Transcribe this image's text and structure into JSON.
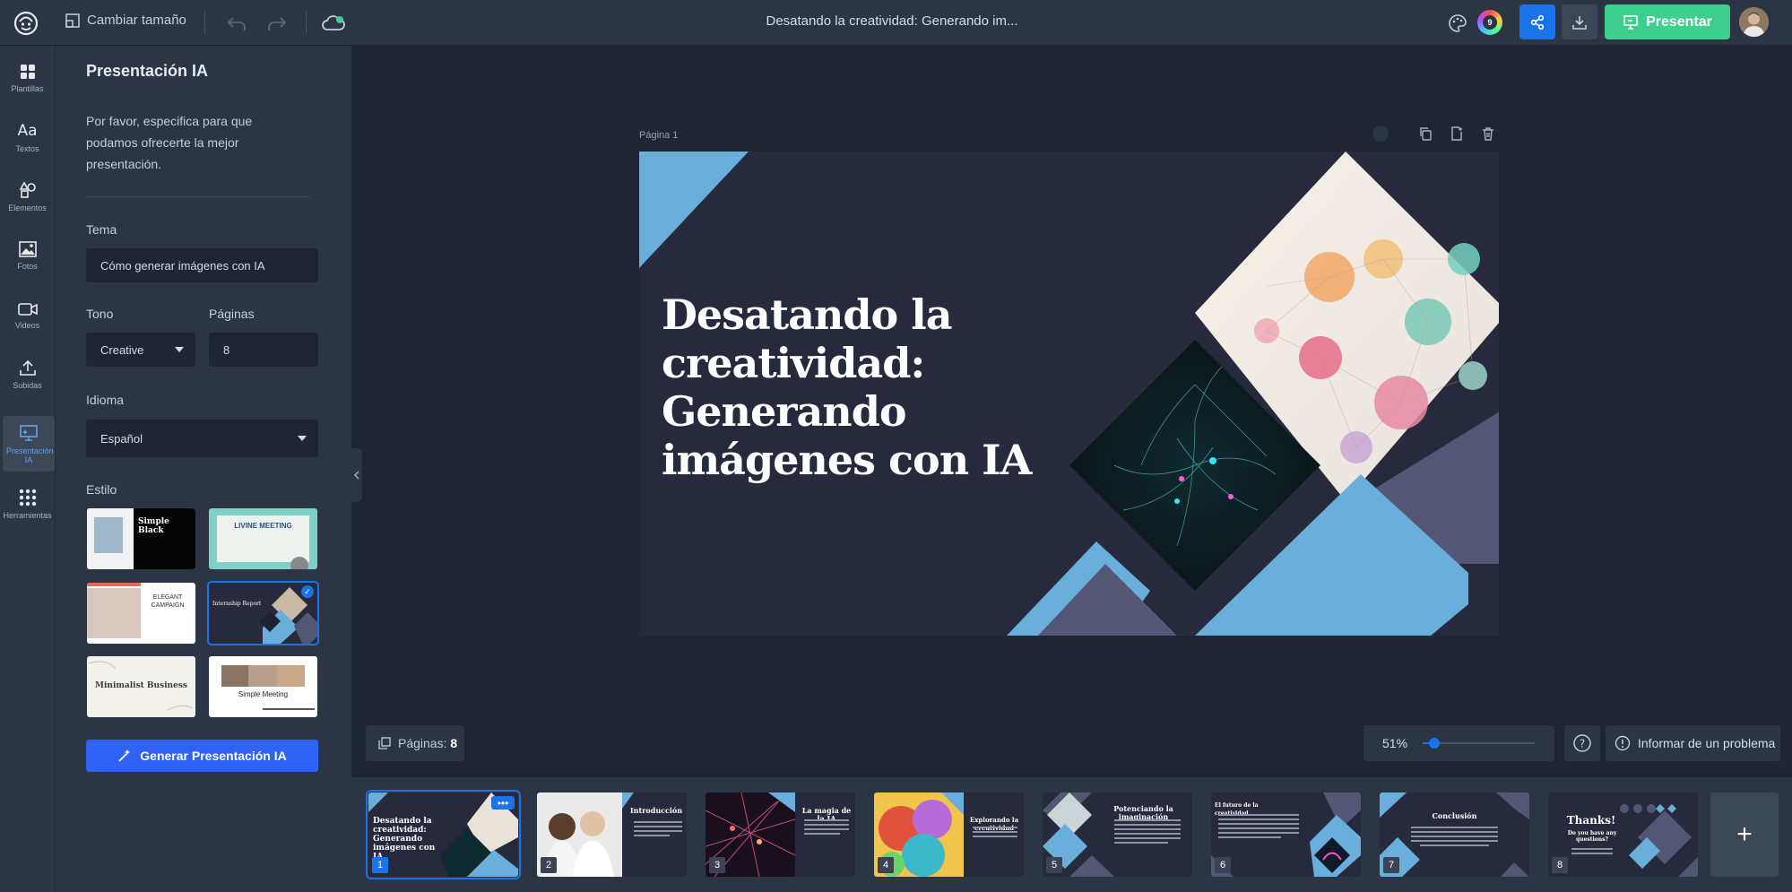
{
  "topbar": {
    "resize_label": "Cambiar tamaño",
    "document_title": "Desatando la creatividad: Generando im...",
    "color_badge": "9",
    "present_label": "Presentar"
  },
  "rail": {
    "items": [
      {
        "label": "Plantillas",
        "icon": "templates-icon"
      },
      {
        "label": "Textos",
        "icon": "text-icon"
      },
      {
        "label": "Elementos",
        "icon": "elements-icon"
      },
      {
        "label": "Fotos",
        "icon": "photos-icon"
      },
      {
        "label": "Videos",
        "icon": "video-icon"
      },
      {
        "label": "Subidas",
        "icon": "upload-icon"
      },
      {
        "label": "Presentación IA",
        "icon": "ai-presentation-icon"
      },
      {
        "label": "Herramientas",
        "icon": "tools-icon"
      }
    ]
  },
  "panel": {
    "title": "Presentación IA",
    "description": "Por favor, especifica para que podamos ofrecerte la mejor presentación.",
    "topic_label": "Tema",
    "topic_value": "Cómo generar imágenes con IA",
    "tone_label": "Tono",
    "tone_value": "Creative",
    "pages_label": "Páginas",
    "pages_value": "8",
    "language_label": "Idioma",
    "language_value": "Español",
    "style_label": "Estilo",
    "styles": [
      {
        "name": "Simple Black"
      },
      {
        "name": "LIVINE MEETING"
      },
      {
        "name": "ELEGANT CAMPAIGN"
      },
      {
        "name": "Internship Report",
        "selected": true
      },
      {
        "name": "Minimalist Business"
      },
      {
        "name": "Simple Meeting"
      }
    ],
    "generate_label": "Generar Presentación IA"
  },
  "canvas": {
    "page_label": "Página 1",
    "slide_title": "Desatando la creatividad: Generando imágenes con IA"
  },
  "bottom": {
    "pages_prefix": "Páginas:",
    "pages_count": "8",
    "zoom_label": "51%",
    "zoom_level": 0.51,
    "report_label": "Informar de un problema"
  },
  "thumbnails": [
    {
      "num": "1",
      "title": "Desatando la creatividad: Generando imágenes con IA"
    },
    {
      "num": "2",
      "title": "Introducción"
    },
    {
      "num": "3",
      "title": "La magia de la IA"
    },
    {
      "num": "4",
      "title": "Explorando la creatividad"
    },
    {
      "num": "5",
      "title": "Potenciando la imaginación"
    },
    {
      "num": "6",
      "title": "El futuro de la creatividad"
    },
    {
      "num": "7",
      "title": "Conclusión"
    },
    {
      "num": "8",
      "title": "Thanks!",
      "subtitle": "Do you have any questions?"
    }
  ],
  "colors": {
    "accent_blue": "#1a73e8",
    "present_green": "#3ecf8e",
    "slide_background": "#272a3c",
    "slide_shape_blue": "#6aaedc",
    "slide_shape_gray": "#545676"
  }
}
